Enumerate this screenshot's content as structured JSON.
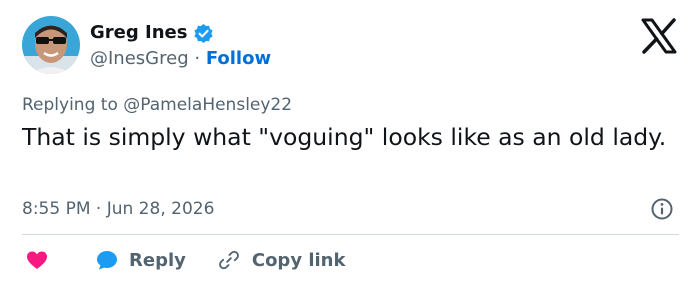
{
  "author": {
    "name": "Greg Ines",
    "handle": "@InesGreg",
    "separator": "·",
    "follow_label": "Follow"
  },
  "reply_context": {
    "prefix": "Replying to ",
    "mention": "@PamelaHensley22"
  },
  "tweet": {
    "text": "That is simply what \"voguing\" looks like as an old lady.",
    "time": "8:55 PM",
    "separator": "·",
    "date": "Jun 28, 2026"
  },
  "actions": {
    "reply_label": "Reply",
    "copy_label": "Copy link"
  },
  "icons": {
    "logo": "x-logo-icon",
    "verified": "verified-badge-icon",
    "info": "info-icon",
    "like": "heart-icon",
    "reply": "reply-bubble-icon",
    "copy": "link-icon"
  },
  "colors": {
    "text": "#0f1419",
    "secondary": "#536471",
    "link": "#006fd6",
    "verified": "#1d9bf0",
    "like": "#f91880",
    "divider": "#cfd9de"
  }
}
